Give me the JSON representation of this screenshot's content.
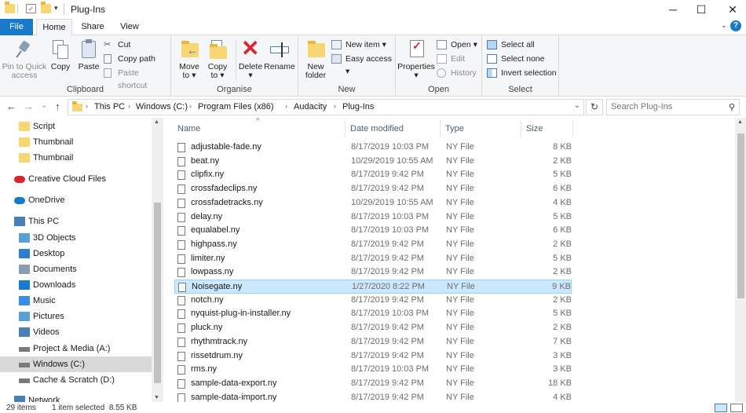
{
  "window": {
    "title": "Plug-Ins",
    "minimize": "─",
    "maximize": "☐",
    "close": "✕"
  },
  "ribbon_tabs": {
    "file": "File",
    "home": "Home",
    "share": "Share",
    "view": "View",
    "collapse": "⌄",
    "help": "?"
  },
  "clipboard": {
    "pin_label": "Pin to Quick\naccess",
    "pin_line1": "Pin to Quick",
    "pin_line2": "access",
    "copy": "Copy",
    "paste": "Paste",
    "cut": "Cut",
    "copy_path": "Copy path",
    "paste_shortcut": "Paste shortcut",
    "group": "Clipboard"
  },
  "organise": {
    "move_line1": "Move",
    "move_line2": "to ▾",
    "copy_line1": "Copy",
    "copy_line2": "to ▾",
    "delete": "Delete ▾",
    "rename": "Rename",
    "group": "Organise"
  },
  "new": {
    "folder_line1": "New",
    "folder_line2": "folder",
    "new_item": "New item ▾",
    "easy_access": "Easy access ▾",
    "group": "New"
  },
  "open": {
    "properties": "Properties",
    "properties_arrow": "▾",
    "open": "Open ▾",
    "edit": "Edit",
    "history": "History",
    "group": "Open"
  },
  "select": {
    "select_all": "Select all",
    "select_none": "Select none",
    "invert": "Invert selection",
    "group": "Select"
  },
  "address": {
    "back": "←",
    "forward": "→",
    "recent": "⌄",
    "up": "↑",
    "crumbs": [
      "This PC",
      "Windows (C:)",
      "Program Files (x86)",
      "Audacity",
      "Plug-Ins"
    ],
    "sep": "›",
    "dropdown": "⌄",
    "refresh": "↻",
    "search_placeholder": "Search Plug-Ins",
    "search_icon": "⚲"
  },
  "nav": [
    {
      "label": "Script",
      "icon": "folder-icon"
    },
    {
      "label": "Thumbnail",
      "icon": "folder-icon"
    },
    {
      "label": "Thumbnail",
      "icon": "folder-icon"
    },
    {
      "label": "Creative Cloud Files",
      "icon": "creative-cloud-icon"
    },
    {
      "label": "OneDrive",
      "icon": "onedrive-icon"
    },
    {
      "label": "This PC",
      "icon": "this-pc-icon"
    },
    {
      "label": "3D Objects",
      "icon": "3d-objects-icon"
    },
    {
      "label": "Desktop",
      "icon": "desktop-icon"
    },
    {
      "label": "Documents",
      "icon": "documents-icon"
    },
    {
      "label": "Downloads",
      "icon": "downloads-icon"
    },
    {
      "label": "Music",
      "icon": "music-icon"
    },
    {
      "label": "Pictures",
      "icon": "pictures-icon"
    },
    {
      "label": "Videos",
      "icon": "videos-icon"
    },
    {
      "label": "Project & Media (A:)",
      "icon": "drive-icon"
    },
    {
      "label": "Windows (C:)",
      "icon": "drive-icon"
    },
    {
      "label": "Cache & Scratch (D:)",
      "icon": "drive-icon"
    },
    {
      "label": "Network",
      "icon": "network-icon"
    }
  ],
  "columns": {
    "name": "Name",
    "date": "Date modified",
    "type": "Type",
    "size": "Size",
    "sort_indicator": "^"
  },
  "files": [
    {
      "name": "adjustable-fade.ny",
      "date": "8/17/2019 10:03 PM",
      "type": "NY File",
      "size": "8 KB"
    },
    {
      "name": "beat.ny",
      "date": "10/29/2019 10:55 AM",
      "type": "NY File",
      "size": "2 KB"
    },
    {
      "name": "clipfix.ny",
      "date": "8/17/2019 9:42 PM",
      "type": "NY File",
      "size": "5 KB"
    },
    {
      "name": "crossfadeclips.ny",
      "date": "8/17/2019 9:42 PM",
      "type": "NY File",
      "size": "6 KB"
    },
    {
      "name": "crossfadetracks.ny",
      "date": "10/29/2019 10:55 AM",
      "type": "NY File",
      "size": "4 KB"
    },
    {
      "name": "delay.ny",
      "date": "8/17/2019 10:03 PM",
      "type": "NY File",
      "size": "5 KB"
    },
    {
      "name": "equalabel.ny",
      "date": "8/17/2019 10:03 PM",
      "type": "NY File",
      "size": "6 KB"
    },
    {
      "name": "highpass.ny",
      "date": "8/17/2019 9:42 PM",
      "type": "NY File",
      "size": "2 KB"
    },
    {
      "name": "limiter.ny",
      "date": "8/17/2019 9:42 PM",
      "type": "NY File",
      "size": "5 KB"
    },
    {
      "name": "lowpass.ny",
      "date": "8/17/2019 9:42 PM",
      "type": "NY File",
      "size": "2 KB"
    },
    {
      "name": "Noisegate.ny",
      "date": "1/27/2020 8:22 PM",
      "type": "NY File",
      "size": "9 KB",
      "selected": true
    },
    {
      "name": "notch.ny",
      "date": "8/17/2019 9:42 PM",
      "type": "NY File",
      "size": "2 KB"
    },
    {
      "name": "nyquist-plug-in-installer.ny",
      "date": "8/17/2019 10:03 PM",
      "type": "NY File",
      "size": "5 KB"
    },
    {
      "name": "pluck.ny",
      "date": "8/17/2019 9:42 PM",
      "type": "NY File",
      "size": "2 KB"
    },
    {
      "name": "rhythmtrack.ny",
      "date": "8/17/2019 9:42 PM",
      "type": "NY File",
      "size": "7 KB"
    },
    {
      "name": "rissetdrum.ny",
      "date": "8/17/2019 9:42 PM",
      "type": "NY File",
      "size": "3 KB"
    },
    {
      "name": "rms.ny",
      "date": "8/17/2019 10:03 PM",
      "type": "NY File",
      "size": "3 KB"
    },
    {
      "name": "sample-data-export.ny",
      "date": "8/17/2019 9:42 PM",
      "type": "NY File",
      "size": "18 KB"
    },
    {
      "name": "sample-data-import.ny",
      "date": "8/17/2019 9:42 PM",
      "type": "NY File",
      "size": "4 KB"
    }
  ],
  "status": {
    "items": "29 items",
    "selected": "1 item selected  8.55 KB"
  },
  "colors": {
    "accent": "#1979ca",
    "selection": "#cce8ff",
    "folder": "#f7d673",
    "delete": "#d9262e"
  }
}
